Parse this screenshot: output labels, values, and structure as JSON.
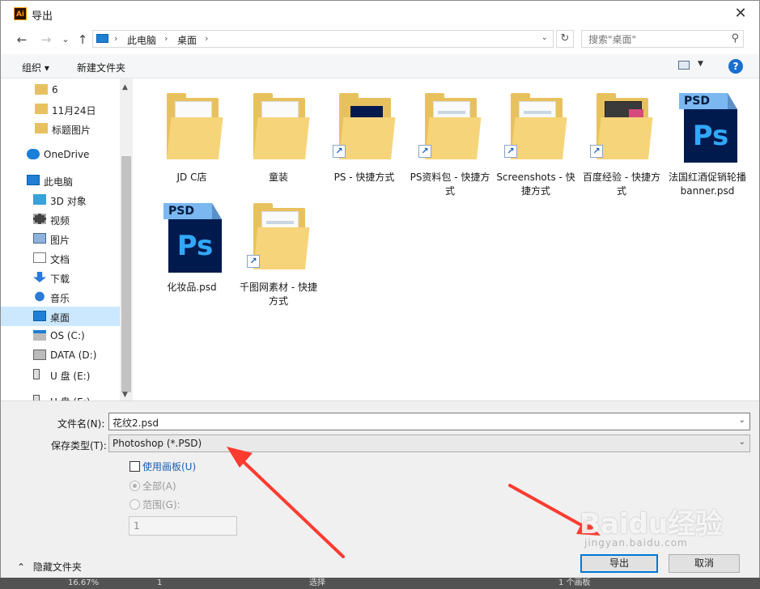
{
  "window": {
    "title": "导出",
    "app_icon": "Ai",
    "close": "✕"
  },
  "nav": {
    "back": "←",
    "forward": "→",
    "recent": "⌄",
    "up": "↑",
    "refresh": "↻"
  },
  "address": {
    "crumbs": [
      "此电脑",
      "桌面"
    ],
    "sep": "›"
  },
  "search": {
    "placeholder": "搜索\"桌面\""
  },
  "toolbar": {
    "organize": "组织 ▾",
    "new_folder": "新建文件夹",
    "help": "?"
  },
  "sidebar": {
    "items": [
      {
        "label": "6",
        "icon": "folder-icon",
        "selected": false
      },
      {
        "label": "11月24日",
        "icon": "folder-icon",
        "selected": false
      },
      {
        "label": "标题图片",
        "icon": "folder-icon",
        "selected": false
      },
      {
        "label": "OneDrive",
        "icon": "cloud-icon",
        "selected": false
      },
      {
        "label": "此电脑",
        "icon": "computer-icon",
        "selected": false
      },
      {
        "label": "3D 对象",
        "icon": "cube-icon",
        "selected": false
      },
      {
        "label": "视频",
        "icon": "video-icon",
        "selected": false
      },
      {
        "label": "图片",
        "icon": "picture-icon",
        "selected": false
      },
      {
        "label": "文档",
        "icon": "document-icon",
        "selected": false
      },
      {
        "label": "下载",
        "icon": "download-icon",
        "selected": false
      },
      {
        "label": "音乐",
        "icon": "music-icon",
        "selected": false
      },
      {
        "label": "桌面",
        "icon": "desktop-icon",
        "selected": true
      },
      {
        "label": "OS (C:)",
        "icon": "os-drive-icon",
        "selected": false
      },
      {
        "label": "DATA (D:)",
        "icon": "drive-icon",
        "selected": false
      },
      {
        "label": "U 盘 (E:)",
        "icon": "usb-drive-icon",
        "selected": false
      },
      {
        "label": "U 盘 (E:)",
        "icon": "usb-drive-icon",
        "selected": false
      }
    ]
  },
  "files": [
    {
      "name": "JD C店",
      "kind": "excel-folder"
    },
    {
      "name": "童装",
      "kind": "excel-folder"
    },
    {
      "name": "PS - 快捷方式",
      "kind": "ps-folder-shortcut"
    },
    {
      "name": "PS资料包 - 快捷方式",
      "kind": "doc-folder-shortcut"
    },
    {
      "name": "Screenshots - 快捷方式",
      "kind": "doc-folder-shortcut"
    },
    {
      "name": "百度经验 - 快捷方式",
      "kind": "photo-folder-shortcut"
    },
    {
      "name": "法国红酒促销轮播banner.psd",
      "kind": "psd"
    },
    {
      "name": "化妆品.psd",
      "kind": "psd"
    },
    {
      "name": "千图网素材 - 快捷方式",
      "kind": "paper-folder-shortcut"
    }
  ],
  "psd_badge": "PSD",
  "ps_mark": "Ps",
  "form": {
    "filename_label": "文件名(N):",
    "filename_value": "花纹2.psd",
    "type_label": "保存类型(T):",
    "type_value": "Photoshop (*.PSD)",
    "use_artboards": "使用画板(U)",
    "all": "全部(A)",
    "range": "范围(G):",
    "range_value": "1",
    "hide_folders": "隐藏文件夹",
    "export": "导出",
    "cancel": "取消"
  },
  "watermark": {
    "text": "Baidu经验",
    "sub": "jingyan.baidu.com"
  },
  "statusbar": {
    "zoom": "16.67%",
    "page": "1",
    "mode": "选择",
    "artboards": "1 个画板"
  },
  "colors": {
    "accent": "#0078d7",
    "selection": "#cce8ff",
    "arrow": "#ff3b30"
  }
}
